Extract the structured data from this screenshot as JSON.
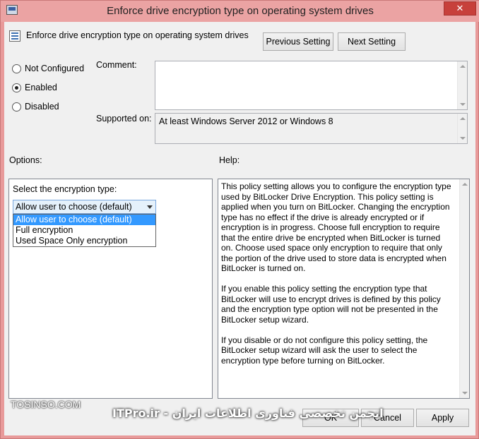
{
  "window": {
    "title": "Enforce drive encryption type on operating system drives",
    "close_glyph": "✕"
  },
  "header": {
    "setting_title": "Enforce drive encryption type on operating system drives",
    "previous_button": "Previous Setting",
    "next_button": "Next Setting"
  },
  "state": {
    "options": [
      {
        "label": "Not Configured",
        "checked": false
      },
      {
        "label": "Enabled",
        "checked": true
      },
      {
        "label": "Disabled",
        "checked": false
      }
    ]
  },
  "comment": {
    "label": "Comment:",
    "value": ""
  },
  "supported": {
    "label": "Supported on:",
    "value": "At least Windows Server 2012 or Windows 8"
  },
  "options_panel": {
    "heading": "Options:",
    "select_label": "Select the encryption type:",
    "selected_value": "Allow user to choose (default)",
    "dropdown_options": [
      "Allow user to choose (default)",
      "Full encryption",
      "Used Space Only encryption"
    ]
  },
  "help_panel": {
    "heading": "Help:",
    "paragraphs": [
      "This policy setting allows you to configure the encryption type used by BitLocker Drive Encryption. This policy setting is applied when you turn on BitLocker. Changing the encryption type has no effect if the drive is already encrypted or if encryption is in progress. Choose full encryption to require that the entire drive be encrypted when BitLocker is turned on. Choose used space only encryption to require that only the portion of the drive used to store data is encrypted when BitLocker is turned on.",
      "If you enable this policy setting the encryption type that BitLocker will use to encrypt drives is defined by this policy and the encryption type option will not be presented in the BitLocker setup wizard.",
      "If you disable or do not configure this policy setting, the BitLocker setup wizard will ask the user to select the encryption type before turning on BitLocker."
    ]
  },
  "footer": {
    "ok_button": "OK",
    "cancel_button": "Cancel",
    "apply_button": "Apply"
  },
  "watermark": {
    "left": "TOSINSO.COM",
    "center": "انجمن تخصصی فناوری اطلاعات ایران - ITPro.ir"
  }
}
